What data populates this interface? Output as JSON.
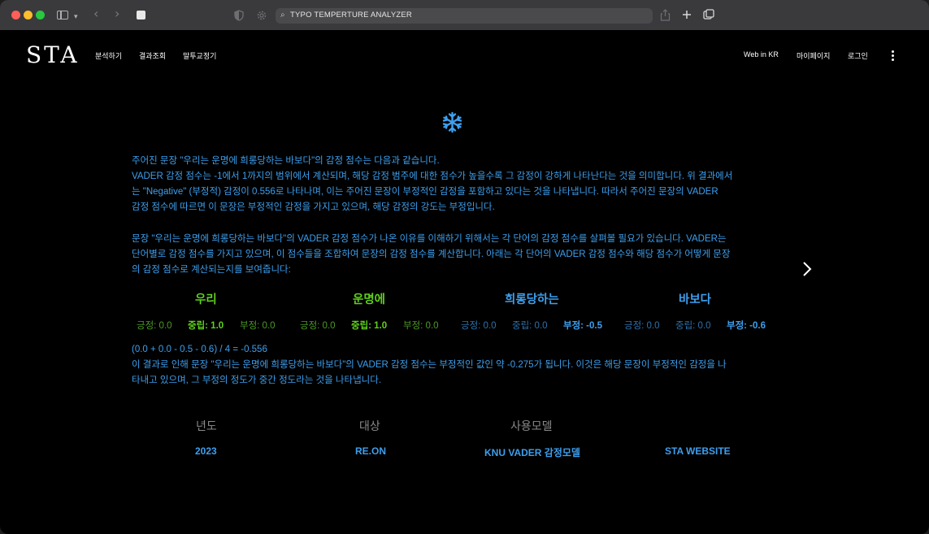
{
  "browser": {
    "url": "TYPO TEMPERTURE ANALYZER"
  },
  "site": {
    "logo": "STA",
    "nav_left": [
      "분석하기",
      "결과조회",
      "말투교정기"
    ],
    "nav_right": [
      "Web in KR",
      "마이페이지",
      "로그인"
    ]
  },
  "content": {
    "intro_lines": [
      "주어진 문장 \"우리는 운명에 희롱당하는 바보다\"의 감정 점수는 다음과 같습니다.",
      "VADER 감정 점수는 -1에서 1까지의 범위에서 계산되며, 해당 감정 범주에 대한 점수가 높을수록 그 감정이 강하게 나타난다는 것을 의미합니다. 위 결과에서",
      "는 \"Negative\" (부정적) 감정이 0.556로 나타나며, 이는 주어진 문장이 부정적인 감정을 포함하고 있다는 것을 나타냅니다. 따라서 주어진 문장의 VADER",
      "감정 점수에 따르면 이 문장은 부정적인 감정을 가지고 있으며, 해당 감정의 강도는 부정입니다."
    ],
    "explain_lines": [
      "문장 \"우리는 운명에 희롱당하는 바보다\"의 VADER 감정 점수가 나온 이유를 이해하기 위해서는 각 단어의 감정 점수를 살펴볼 필요가 있습니다. VADER는",
      "단어별로 감정 점수를 가지고 있으며, 이 점수들을 조합하여 문장의 감정 점수를 계산합니다. 아래는 각 단어의 VADER 감정 점수와 해당 점수가 어떻게 문장",
      "의 감정 점수로 계산되는지를 보여줍니다:"
    ],
    "words": [
      {
        "word": "우리",
        "positive": "긍정: 0.0",
        "neutral": "중립: 1.0",
        "negative": "부정: 0.0"
      },
      {
        "word": "운명에",
        "positive": "긍정: 0.0",
        "neutral": "중립: 1.0",
        "negative": "부정: 0.0"
      },
      {
        "word": "희롱당하는",
        "positive": "긍정: 0.0",
        "neutral": "중립: 0.0",
        "negative": "부정: -0.5"
      },
      {
        "word": "바보다",
        "positive": "긍정: 0.0",
        "neutral": "중립: 0.0",
        "negative": "부정: -0.6"
      }
    ],
    "result_lines": [
      "(0.0 + 0.0 - 0.5 - 0.6) / 4 = -0.556",
      "이 결과로 인해 문장 \"우리는 운명에 희롱당하는 바보다\"의 VADER 감정 점수는 부정적인 값인 약 -0.275가 됩니다. 이것은 해당 문장이 부정적인 감정을 나",
      "타내고 있으며, 그 부정의 정도가 중간 정도라는 것을 나타냅니다."
    ]
  },
  "info": {
    "labels": [
      "년도",
      "대상",
      "사용모델"
    ],
    "values": [
      "2023",
      "RE.ON",
      "KNU VADER 감정모델",
      "STA WEBSITE"
    ]
  },
  "colors": {
    "accent_blue": "#3d9fee",
    "accent_green": "#5fd01c"
  }
}
